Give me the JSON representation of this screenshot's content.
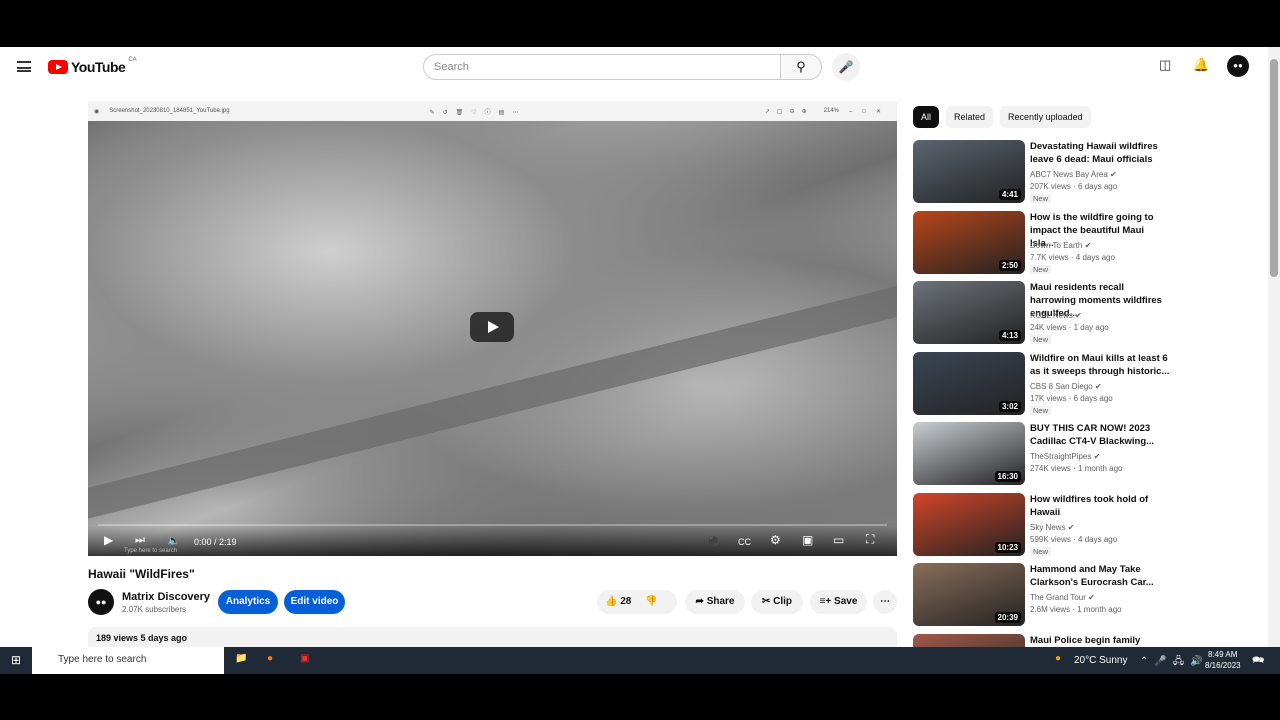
{
  "header": {
    "logo": "YouTube",
    "country": "CA",
    "search_placeholder": "Search"
  },
  "viewer": {
    "filename": "Screenshot_20230810_184851_YouTube.jpg",
    "zoom": "214%"
  },
  "player": {
    "time": "0:00 / 2:19",
    "overlay_taskbar_search": "Type here to search"
  },
  "video": {
    "title": "Hawaii \"WildFires\"",
    "channel": "Matrix Discovery",
    "subscribers": "2.07K subscribers",
    "analytics": "Analytics",
    "edit": "Edit video",
    "likes": "28",
    "share": "Share",
    "clip": "Clip",
    "save": "Save",
    "views_date": "189 views  5 days ago"
  },
  "chips": [
    "All",
    "Related",
    "Recently uploaded"
  ],
  "recs": [
    {
      "title": "Devastating Hawaii wildfires leave 6 dead: Maui officials",
      "channel": "ABC7 News Bay Area",
      "meta": "207K views · 6 days ago",
      "badge": "New",
      "duration": "4:41",
      "color": "#5b6570"
    },
    {
      "title": "How is the wildfire going to impact the beautiful Maui Isla...",
      "channel": "Down To Earth",
      "meta": "7.7K views · 4 days ago",
      "badge": "New",
      "duration": "2:50",
      "color": "#b8461a"
    },
    {
      "title": "Maui residents recall harrowing moments wildfires engulfed...",
      "channel": "KCAL News",
      "meta": "24K views · 1 day ago",
      "badge": "New",
      "duration": "4:13",
      "color": "#6d737a"
    },
    {
      "title": "Wildfire on Maui kills at least 6 as it sweeps through historic...",
      "channel": "CBS 8 San Diego",
      "meta": "17K views · 6 days ago",
      "badge": "New",
      "duration": "3:02",
      "color": "#3b4654"
    },
    {
      "title": "BUY THIS CAR NOW! 2023 Cadillac CT4-V Blackwing...",
      "channel": "TheStraightPipes",
      "meta": "274K views · 1 month ago",
      "badge": "",
      "duration": "16:30",
      "color": "#c9ced3"
    },
    {
      "title": "How wildfires took hold of Hawaii",
      "channel": "Sky News",
      "meta": "599K views · 4 days ago",
      "badge": "New",
      "duration": "10:23",
      "color": "#d2452a"
    },
    {
      "title": "Hammond and May Take Clarkson's Eurocrash Car...",
      "channel": "The Grand Tour",
      "meta": "2.6M views · 1 month ago",
      "badge": "",
      "duration": "20:39",
      "color": "#8a6e5a"
    },
    {
      "title": "Maui Police begin family",
      "channel": "",
      "meta": "",
      "badge": "",
      "duration": "",
      "color": "#a05a4a"
    }
  ],
  "taskbar": {
    "search": "Type here to search",
    "weather": "20°C  Sunny",
    "time": "8:49 AM",
    "date": "8/16/2023"
  }
}
